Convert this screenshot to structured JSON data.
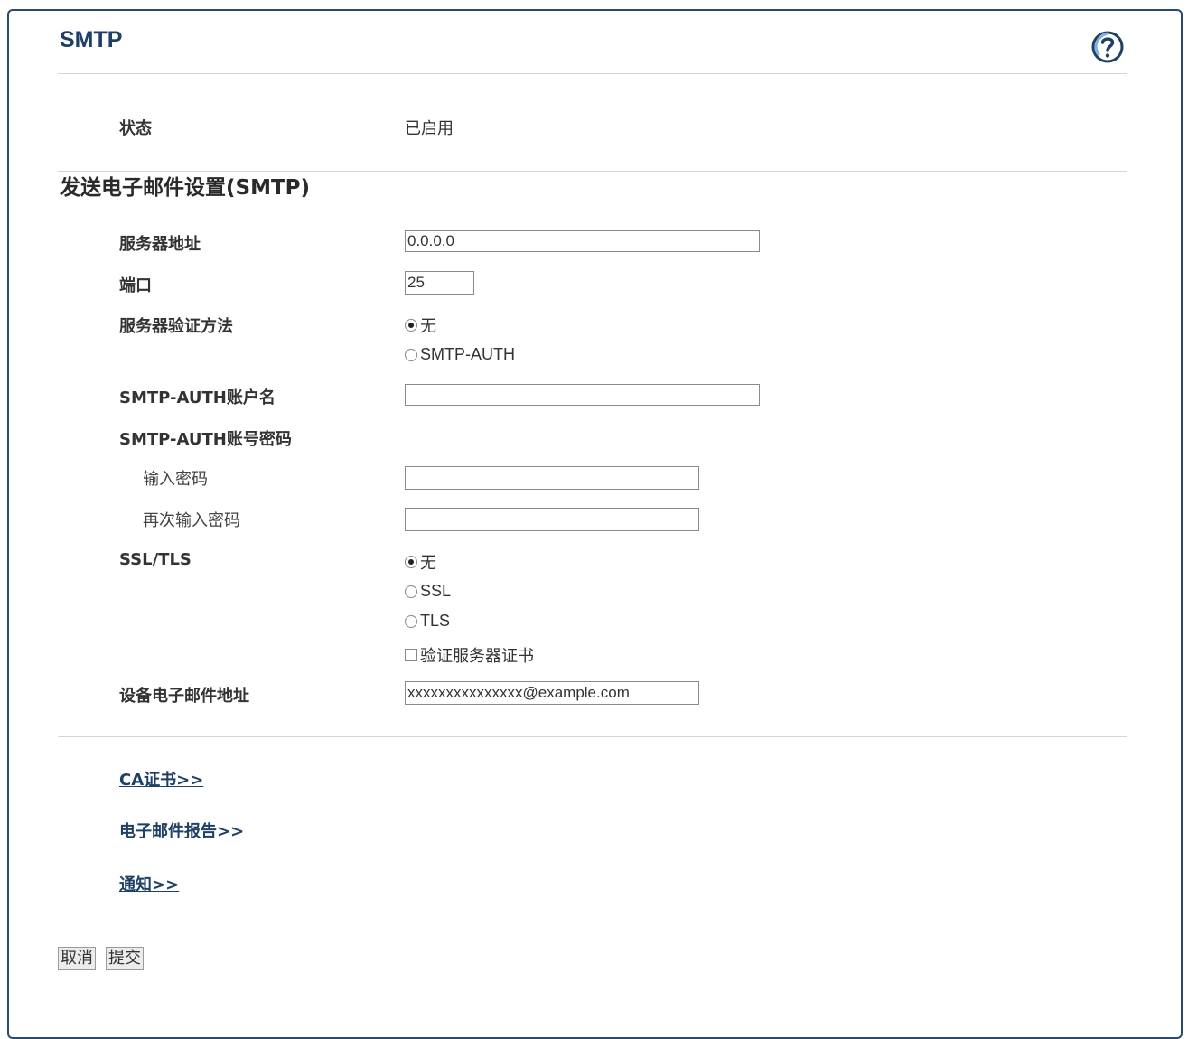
{
  "header": {
    "title": "SMTP",
    "help_icon": "help-question-icon"
  },
  "status": {
    "label": "状态",
    "value": "已启用"
  },
  "section": {
    "title": "发送电子邮件设置(SMTP)"
  },
  "server_address": {
    "label": "服务器地址",
    "value": "0.0.0.0"
  },
  "port": {
    "label": "端口",
    "value": "25"
  },
  "auth_method": {
    "label": "服务器验证方法",
    "options": [
      "无",
      "SMTP-AUTH"
    ],
    "selected": "无"
  },
  "auth_account": {
    "label": "SMTP-AUTH账户名",
    "value": ""
  },
  "auth_password": {
    "label": "SMTP-AUTH账号密码",
    "enter_label": "输入密码",
    "reenter_label": "再次输入密码",
    "enter_value": "",
    "reenter_value": ""
  },
  "ssl_tls": {
    "label": "SSL/TLS",
    "options": [
      "无",
      "SSL",
      "TLS"
    ],
    "selected": "无",
    "verify_cert_label": "验证服务器证书",
    "verify_cert_checked": false
  },
  "device_email": {
    "label": "设备电子邮件地址",
    "value": "xxxxxxxxxxxxxxx@example.com"
  },
  "links": {
    "ca_cert": "CA证书>>",
    "email_report": "电子邮件报告>>",
    "notification": "通知>>"
  },
  "buttons": {
    "cancel": "取消",
    "submit": "提交"
  }
}
